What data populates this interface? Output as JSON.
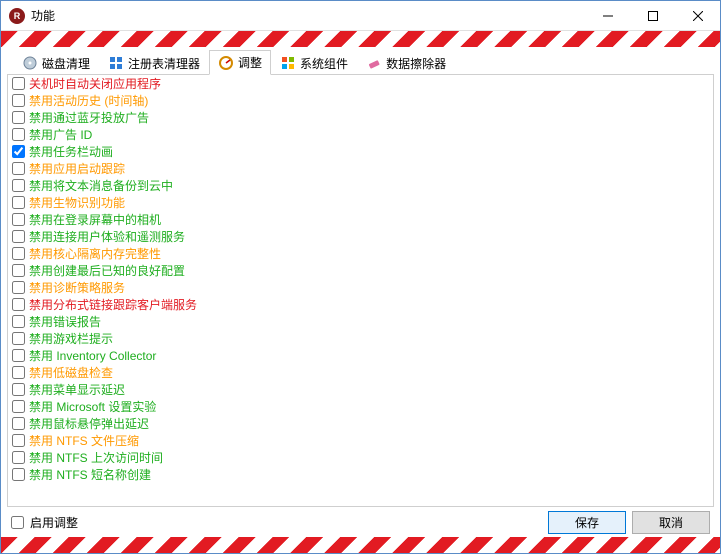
{
  "window": {
    "title": "功能"
  },
  "tabs": [
    {
      "label": "磁盘清理"
    },
    {
      "label": "注册表清理器"
    },
    {
      "label": "调整"
    },
    {
      "label": "系统组件"
    },
    {
      "label": "数据擦除器"
    }
  ],
  "active_tab_index": 2,
  "items": [
    {
      "label": "关机时自动关闭应用程序",
      "color": "red",
      "checked": false
    },
    {
      "label": "禁用活动历史 (时间轴)",
      "color": "orange",
      "checked": false
    },
    {
      "label": "禁用通过蓝牙投放广告",
      "color": "green",
      "checked": false
    },
    {
      "label": "禁用广告 ID",
      "color": "green",
      "checked": false
    },
    {
      "label": "禁用任务栏动画",
      "color": "green",
      "checked": true
    },
    {
      "label": "禁用应用启动跟踪",
      "color": "orange",
      "checked": false
    },
    {
      "label": "禁用将文本消息备份到云中",
      "color": "green",
      "checked": false
    },
    {
      "label": "禁用生物识别功能",
      "color": "orange",
      "checked": false
    },
    {
      "label": "禁用在登录屏幕中的相机",
      "color": "green",
      "checked": false
    },
    {
      "label": "禁用连接用户体验和遥测服务",
      "color": "green",
      "checked": false
    },
    {
      "label": "禁用核心隔离内存完整性",
      "color": "orange",
      "checked": false
    },
    {
      "label": "禁用创建最后已知的良好配置",
      "color": "green",
      "checked": false
    },
    {
      "label": "禁用诊断策略服务",
      "color": "orange",
      "checked": false
    },
    {
      "label": "禁用分布式链接跟踪客户端服务",
      "color": "red",
      "checked": false
    },
    {
      "label": "禁用错误报告",
      "color": "green",
      "checked": false
    },
    {
      "label": "禁用游戏栏提示",
      "color": "green",
      "checked": false
    },
    {
      "label": "禁用 Inventory Collector",
      "color": "green",
      "checked": false
    },
    {
      "label": "禁用低磁盘检查",
      "color": "orange",
      "checked": false
    },
    {
      "label": "禁用菜单显示延迟",
      "color": "green",
      "checked": false
    },
    {
      "label": "禁用 Microsoft 设置实验",
      "color": "green",
      "checked": false
    },
    {
      "label": "禁用鼠标悬停弹出延迟",
      "color": "green",
      "checked": false
    },
    {
      "label": "禁用 NTFS 文件压缩",
      "color": "orange",
      "checked": false
    },
    {
      "label": "禁用 NTFS 上次访问时间",
      "color": "green",
      "checked": false
    },
    {
      "label": "禁用 NTFS 短名称创建",
      "color": "green",
      "checked": false
    }
  ],
  "footer": {
    "enable_label": "启用调整",
    "enable_checked": false,
    "save_label": "保存",
    "cancel_label": "取消"
  }
}
